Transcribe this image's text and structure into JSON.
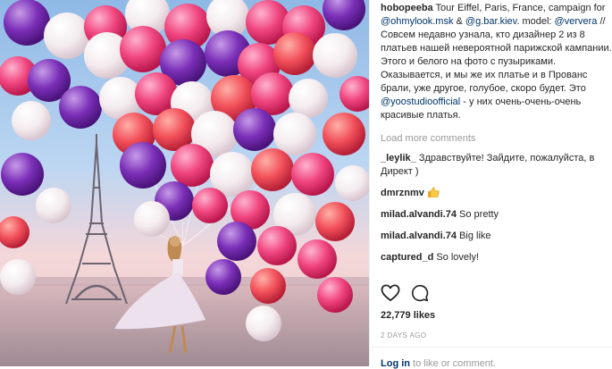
{
  "post": {
    "author": "hobopeeba",
    "caption_parts": [
      {
        "type": "text",
        "text": " Tour Eiffel, Paris, France, campaign for "
      },
      {
        "type": "mention",
        "text": "@ohmylook.msk"
      },
      {
        "type": "text",
        "text": " & "
      },
      {
        "type": "mention",
        "text": "@g.bar.kiev"
      },
      {
        "type": "text",
        "text": ". model: "
      },
      {
        "type": "mention",
        "text": "@ververa"
      },
      {
        "type": "text",
        "text": " // Совсем недавно узнала, кто дизайнер 2 из 8 платьев нашей невероятной парижской кампании. Этого и белого на фото с пузыриками. Оказывается, и мы же их платье и в Прованс брали, уже другое, голубое, скоро будет. Это "
      },
      {
        "type": "mention",
        "text": "@yoostudioofficial"
      },
      {
        "type": "text",
        "text": " - у них очень-очень-очень красивые платья."
      }
    ],
    "load_more": "Load more comments",
    "comments": [
      {
        "user": "_leylik_",
        "text": " Здравствуйте! Зайдите, пожалуйста, в Директ )"
      },
      {
        "user": "dmrznmv",
        "text": " ",
        "emoji": "thumbs-up"
      },
      {
        "user": "milad.alvandi.74",
        "text": " So pretty"
      },
      {
        "user": "milad.alvandi.74",
        "text": " Big like"
      },
      {
        "user": "captured_d",
        "text": " So lovely!"
      }
    ],
    "likes": "22,779 likes",
    "age": "2 DAYS AGO",
    "login_link": "Log in",
    "login_rest": " to like or comment."
  },
  "icons": {
    "like": "heart-outline-icon",
    "comment": "speech-bubble-icon",
    "thumbs": "thumbs-up-icon"
  },
  "colors": {
    "mention": "#003569",
    "muted": "#999999",
    "text": "#262626"
  }
}
